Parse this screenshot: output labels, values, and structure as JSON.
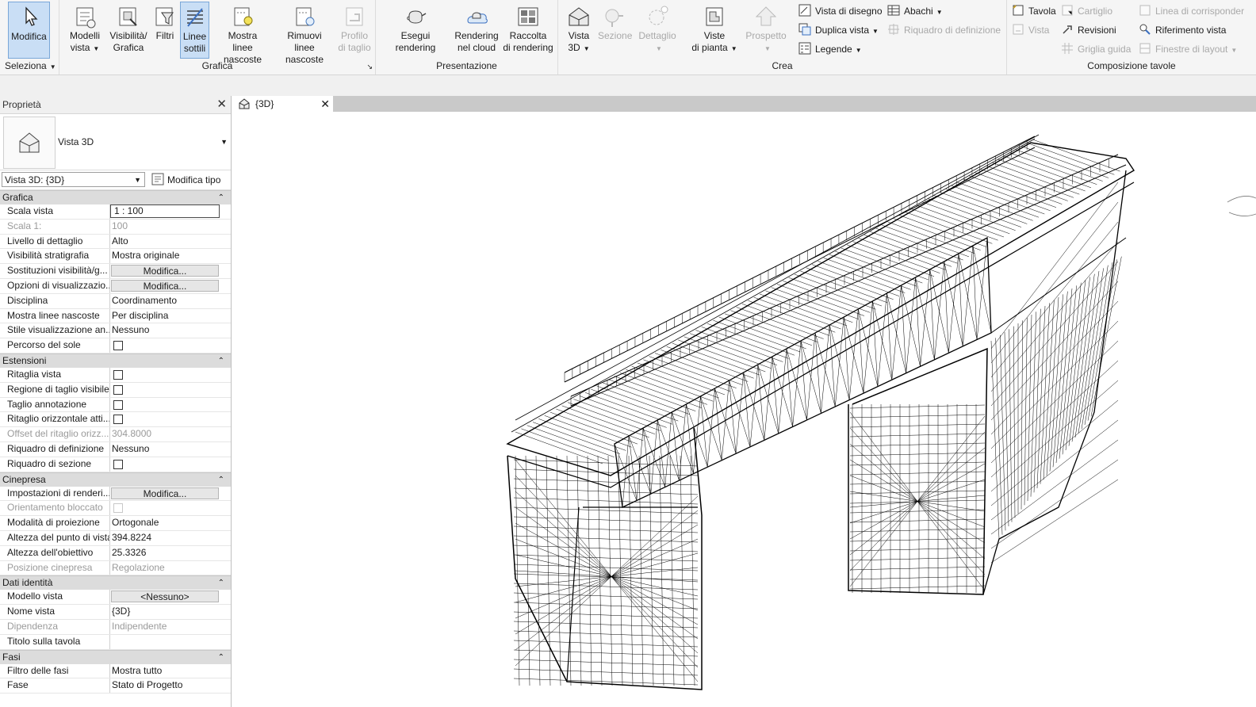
{
  "ribbon": {
    "panels": {
      "seleziona": "Seleziona",
      "grafica": "Grafica",
      "presentazione": "Presentazione",
      "crea": "Crea",
      "composizione": "Composizione tavole"
    },
    "buttons": {
      "modifica": "Modifica",
      "modelli_vista": [
        "Modelli",
        "vista"
      ],
      "visibilita": [
        "Visibilità/",
        "Grafica"
      ],
      "filtri": "Filtri",
      "linee_sottili": [
        "Linee",
        "sottili"
      ],
      "mostra_linee": [
        "Mostra",
        "linee nascoste"
      ],
      "rimuovi_linee": [
        "Rimuovi",
        "linee nascoste"
      ],
      "profilo_taglio": [
        "Profilo",
        "di taglio"
      ],
      "esegui_rendering": "Esegui rendering",
      "rendering_cloud": [
        "Rendering",
        "nel cloud"
      ],
      "raccolta_rendering": [
        "Raccolta",
        "di rendering"
      ],
      "vista_3d": [
        "Vista",
        "3D"
      ],
      "sezione": "Sezione",
      "dettaglio": "Dettaglio",
      "viste_pianta": [
        "Viste",
        "di pianta"
      ],
      "prospetto": "Prospetto",
      "vista_disegno": "Vista di disegno",
      "duplica_vista": "Duplica vista",
      "legende": "Legende",
      "abachi": "Abachi",
      "riquadro_def": "Riquadro di definizione",
      "tavola": "Tavola",
      "vista": "Vista",
      "cartiglio": "Cartiglio",
      "revisioni": "Revisioni",
      "griglia_guida": "Griglia guida",
      "linea_corrisp": "Linea di corrisponder",
      "riferimento_vista": "Riferimento vista",
      "finestre_layout": "Finestre di layout"
    }
  },
  "properties": {
    "title": "Proprietà",
    "type_name": "Vista 3D",
    "instance_selector": "Vista 3D: {3D}",
    "edit_type": "Modifica tipo",
    "groups": [
      {
        "name": "Grafica",
        "rows": [
          {
            "k": "Scala vista",
            "v": "1 : 100",
            "t": "input"
          },
          {
            "k": "Scala  1:",
            "v": "100",
            "t": "gray"
          },
          {
            "k": "Livello di dettaglio",
            "v": "Alto"
          },
          {
            "k": "Visibilità stratigrafia",
            "v": "Mostra originale"
          },
          {
            "k": "Sostituzioni visibilità/g...",
            "v": "Modifica...",
            "t": "btn"
          },
          {
            "k": "Opzioni di visualizzazio...",
            "v": "Modifica...",
            "t": "btn"
          },
          {
            "k": "Disciplina",
            "v": "Coordinamento"
          },
          {
            "k": "Mostra linee nascoste",
            "v": "Per disciplina"
          },
          {
            "k": "Stile visualizzazione an...",
            "v": "Nessuno"
          },
          {
            "k": "Percorso del sole",
            "v": "",
            "t": "chk"
          }
        ]
      },
      {
        "name": "Estensioni",
        "rows": [
          {
            "k": "Ritaglia vista",
            "v": "",
            "t": "chk"
          },
          {
            "k": "Regione di taglio visibile",
            "v": "",
            "t": "chk"
          },
          {
            "k": "Taglio annotazione",
            "v": "",
            "t": "chk"
          },
          {
            "k": "Ritaglio orizzontale atti...",
            "v": "",
            "t": "chk"
          },
          {
            "k": "Offset del ritaglio orizz...",
            "v": "304.8000",
            "t": "gray"
          },
          {
            "k": "Riquadro di definizione",
            "v": "Nessuno"
          },
          {
            "k": "Riquadro di sezione",
            "v": "",
            "t": "chk"
          }
        ]
      },
      {
        "name": "Cinepresa",
        "rows": [
          {
            "k": "Impostazioni di renderi...",
            "v": "Modifica...",
            "t": "btn"
          },
          {
            "k": "Orientamento bloccato",
            "v": "",
            "t": "chkgray"
          },
          {
            "k": "Modalità di proiezione",
            "v": "Ortogonale"
          },
          {
            "k": "Altezza del punto di vista",
            "v": "394.8224"
          },
          {
            "k": "Altezza dell'obiettivo",
            "v": "25.3326"
          },
          {
            "k": "Posizione cinepresa",
            "v": "Regolazione",
            "t": "gray"
          }
        ]
      },
      {
        "name": "Dati identità",
        "rows": [
          {
            "k": "Modello vista",
            "v": "<Nessuno>",
            "t": "btn"
          },
          {
            "k": "Nome vista",
            "v": "{3D}"
          },
          {
            "k": "Dipendenza",
            "v": "Indipendente",
            "t": "gray"
          },
          {
            "k": "Titolo sulla tavola",
            "v": ""
          }
        ]
      },
      {
        "name": "Fasi",
        "rows": [
          {
            "k": "Filtro delle fasi",
            "v": "Mostra tutto"
          },
          {
            "k": "Fase",
            "v": "Stato di Progetto"
          }
        ]
      }
    ]
  },
  "view_tab": {
    "label": "{3D}"
  },
  "canvas": {
    "description_icon": "bridge-wireframe-model"
  }
}
